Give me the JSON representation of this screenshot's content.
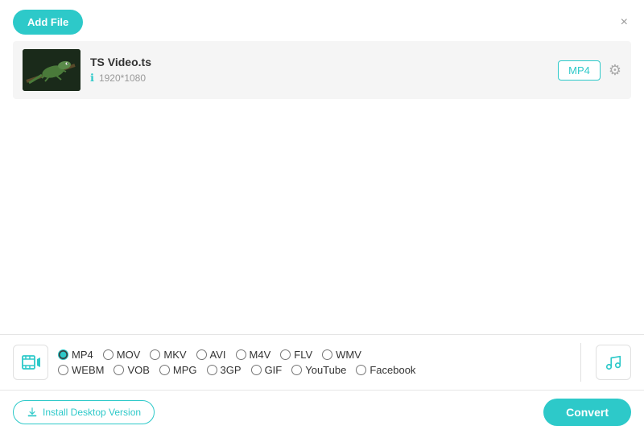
{
  "header": {
    "add_file_label": "Add File",
    "close_icon": "×"
  },
  "file": {
    "name": "TS Video.ts",
    "resolution": "1920*1080",
    "format": "MP4"
  },
  "formats": {
    "row1": [
      {
        "id": "mp4",
        "label": "MP4",
        "selected": true
      },
      {
        "id": "mov",
        "label": "MOV",
        "selected": false
      },
      {
        "id": "mkv",
        "label": "MKV",
        "selected": false
      },
      {
        "id": "avi",
        "label": "AVI",
        "selected": false
      },
      {
        "id": "m4v",
        "label": "M4V",
        "selected": false
      },
      {
        "id": "flv",
        "label": "FLV",
        "selected": false
      },
      {
        "id": "wmv",
        "label": "WMV",
        "selected": false
      }
    ],
    "row2": [
      {
        "id": "webm",
        "label": "WEBM",
        "selected": false
      },
      {
        "id": "vob",
        "label": "VOB",
        "selected": false
      },
      {
        "id": "mpg",
        "label": "MPG",
        "selected": false
      },
      {
        "id": "3gp",
        "label": "3GP",
        "selected": false
      },
      {
        "id": "gif",
        "label": "GIF",
        "selected": false
      },
      {
        "id": "youtube",
        "label": "YouTube",
        "selected": false
      },
      {
        "id": "facebook",
        "label": "Facebook",
        "selected": false
      }
    ]
  },
  "footer": {
    "install_label": "Install Desktop Version",
    "convert_label": "Convert"
  },
  "colors": {
    "accent": "#2dc9c9",
    "border": "#e5e5e5"
  }
}
